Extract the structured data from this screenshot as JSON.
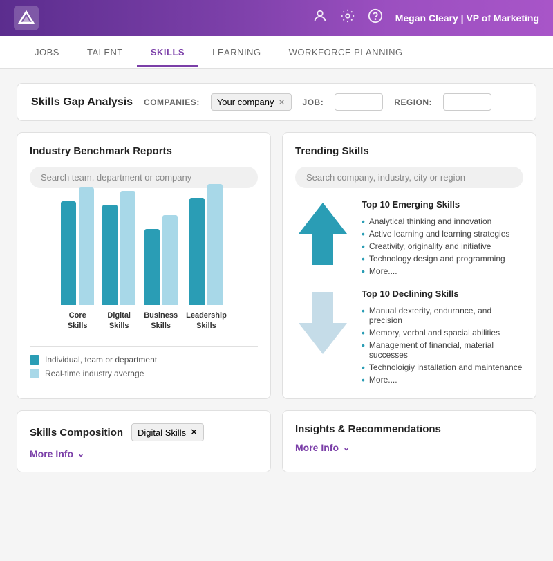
{
  "header": {
    "user": "Megan Cleary | VP of Marketing",
    "logo_alt": "logo"
  },
  "nav": {
    "items": [
      {
        "label": "JOBS",
        "active": false
      },
      {
        "label": "TALENT",
        "active": false
      },
      {
        "label": "SKILLS",
        "active": true
      },
      {
        "label": "LEARNING",
        "active": false
      },
      {
        "label": "WORKFORCE PLANNING",
        "active": false
      }
    ]
  },
  "skills_gap": {
    "title": "Skills Gap Analysis",
    "companies_label": "COMPANIES:",
    "company_tag": "Your company",
    "job_label": "JOB:",
    "region_label": "REGION:"
  },
  "industry_benchmark": {
    "title": "Industry Benchmark Reports",
    "search_placeholder": "Search team, department or company",
    "bars": [
      {
        "label": "Core\nSkills",
        "dark_height": 150,
        "light_height": 170
      },
      {
        "label": "Digital\nSkills",
        "dark_height": 145,
        "light_height": 165
      },
      {
        "label": "Business\nSkills",
        "dark_height": 110,
        "light_height": 130
      },
      {
        "label": "Leadership\nSkills",
        "dark_height": 155,
        "light_height": 175
      }
    ],
    "legend": [
      {
        "color": "#2a9db5",
        "label": "Individual, team or department"
      },
      {
        "color": "#a8d8e8",
        "label": "Real-time industry average"
      }
    ]
  },
  "trending_skills": {
    "title": "Trending Skills",
    "search_placeholder": "Search company, industry, city or region",
    "emerging": {
      "title": "Top 10 Emerging Skills",
      "items": [
        "Analytical thinking and innovation",
        "Active learning and learning strategies",
        "Creativity, originality and initiative",
        "Technology design and programming",
        "More...."
      ]
    },
    "declining": {
      "title": "Top 10 Declining Skills",
      "items": [
        "Manual dexterity, endurance, and precision",
        "Memory, verbal and spacial abilities",
        "Management of financial, material successes",
        "Technoloigiy installation and maintenance",
        "More...."
      ]
    }
  },
  "skills_composition": {
    "title": "Skills Composition",
    "tag": "Digital Skills",
    "more_info": "More Info"
  },
  "insights": {
    "title": "Insights & Recommendations",
    "more_info": "More Info"
  }
}
